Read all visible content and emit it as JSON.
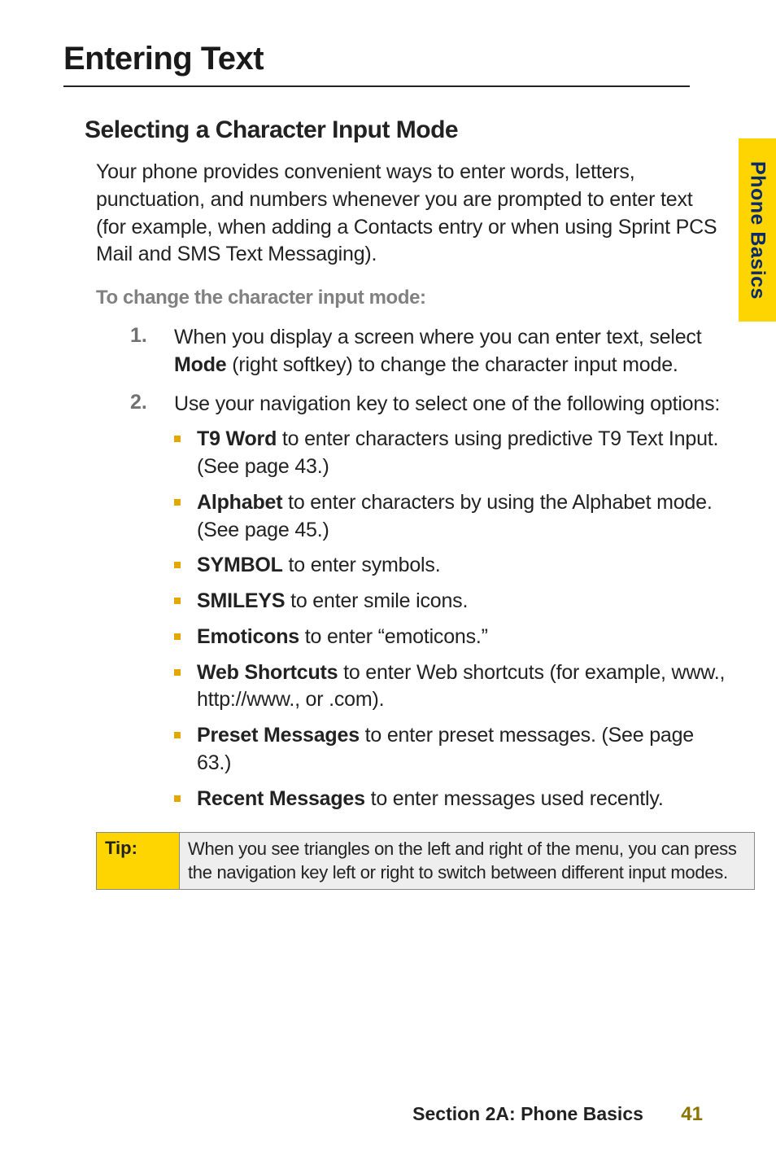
{
  "side_tab": "Phone Basics",
  "title": "Entering Text",
  "subtitle": "Selecting a Character Input Mode",
  "intro": "Your phone provides convenient ways to enter words, letters, punctuation, and numbers whenever you are prompted to enter text (for example, when adding a Contacts entry or when using Sprint PCS Mail and SMS Text Messaging).",
  "sub_head": "To change the character input mode:",
  "steps": [
    {
      "num": "1.",
      "pre": "When you display a screen where you can enter text, select ",
      "bold": "Mode",
      "post": " (right softkey) to change the character input mode."
    },
    {
      "num": "2.",
      "pre": "Use your navigation key to select one of the following options:",
      "bold": "",
      "post": ""
    }
  ],
  "options": [
    {
      "bold": "T9 Word",
      "rest": " to enter characters using predictive T9 Text Input. (See page 43.)"
    },
    {
      "bold": "Alphabet",
      "rest": " to enter characters by using the Alphabet mode. (See page 45.)"
    },
    {
      "bold": "SYMBOL",
      "rest": " to enter symbols."
    },
    {
      "bold": "SMILEYS",
      "rest": " to enter smile icons."
    },
    {
      "bold": "Emoticons",
      "rest": " to enter “emoticons.”"
    },
    {
      "bold": "Web Shortcuts",
      "rest": " to enter Web shortcuts (for example, www., http://www., or .com)."
    },
    {
      "bold": "Preset Messages",
      "rest": " to enter preset messages. (See page 63.)"
    },
    {
      "bold": "Recent Messages",
      "rest": " to enter messages used recently."
    }
  ],
  "tip_label": "Tip:",
  "tip_body": "When you see triangles on the left and right of the menu, you can press the navigation key left or right to switch between different input modes.",
  "footer_section": "Section 2A: Phone Basics",
  "footer_page": "41"
}
